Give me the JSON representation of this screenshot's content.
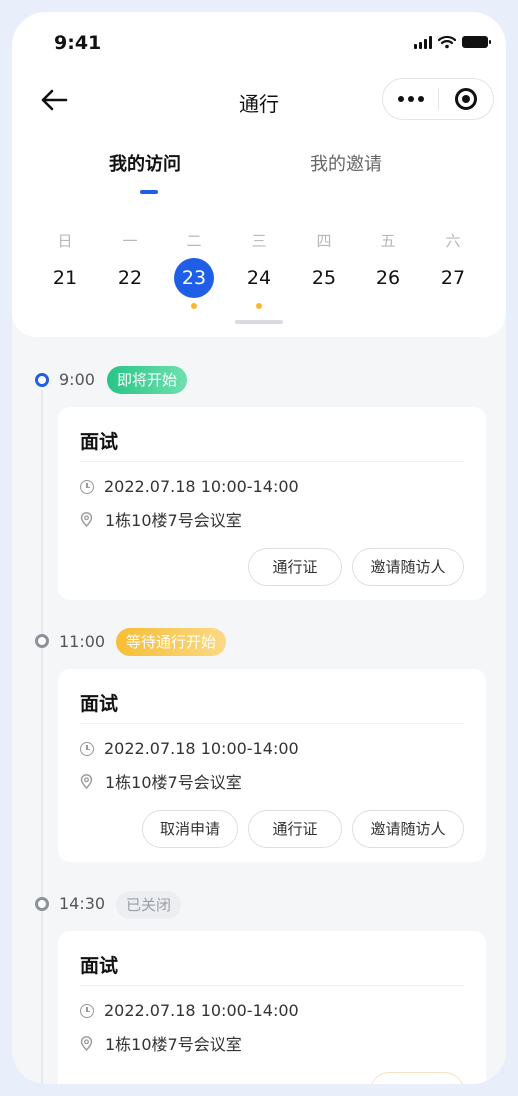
{
  "status": {
    "time": "9:41"
  },
  "nav": {
    "title": "通行"
  },
  "tabs": [
    {
      "label": "我的访问",
      "active": true
    },
    {
      "label": "我的邀请",
      "active": false
    }
  ],
  "calendar": {
    "weekdays": [
      "日",
      "一",
      "二",
      "三",
      "四",
      "五",
      "六"
    ],
    "dates": [
      "21",
      "22",
      "23",
      "24",
      "25",
      "26",
      "27"
    ],
    "selected": "23",
    "marked": [
      "23",
      "24"
    ]
  },
  "timeline": [
    {
      "time": "9:00",
      "status": "即将开始",
      "card": {
        "title": "面试",
        "datetime": "2022.07.18 10:00-14:00",
        "location": "1栋10楼7号会议室",
        "buttons": [
          "通行证",
          "邀请随访人"
        ]
      }
    },
    {
      "time": "11:00",
      "status": "等待通行开始",
      "card": {
        "title": "面试",
        "datetime": "2022.07.18 10:00-14:00",
        "location": "1栋10楼7号会议室",
        "buttons": [
          "取消申请",
          "通行证",
          "邀请随访人"
        ]
      }
    },
    {
      "time": "14:30",
      "status": "已关闭",
      "card": {
        "title": "面试",
        "datetime": "2022.07.18 10:00-14:00",
        "location": "1栋10楼7号会议室",
        "buttons": []
      }
    }
  ],
  "colors": {
    "accent": "#1f5fe8",
    "green": "#28c486",
    "yellow": "#f7bd35",
    "dot": "#f5b830"
  }
}
